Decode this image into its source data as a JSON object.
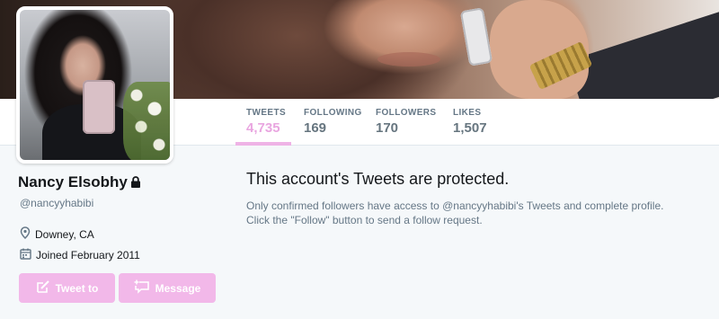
{
  "profile": {
    "name": "Nancy Elsobhy",
    "handle": "@nancyyhabibi",
    "location": "Downey, CA",
    "joined": "Joined February 2011"
  },
  "stats": [
    {
      "label": "TWEETS",
      "value": "4,735",
      "active": true
    },
    {
      "label": "FOLLOWING",
      "value": "169",
      "active": false
    },
    {
      "label": "FOLLOWERS",
      "value": "170",
      "active": false
    },
    {
      "label": "LIKES",
      "value": "1,507",
      "active": false
    }
  ],
  "actions": {
    "tweet_to": "Tweet to",
    "message": "Message"
  },
  "protected": {
    "title": "This account's Tweets are protected.",
    "line1": "Only confirmed followers have access to @nancyyhabibi's Tweets and complete profile.",
    "line2": "Click the \"Follow\" button to send a follow request."
  },
  "icons": {
    "lock": "lock-icon",
    "location": "location-pin-icon",
    "joined": "calendar-icon",
    "tweet": "compose-icon",
    "message": "message-icon"
  },
  "colors": {
    "accent": "#efb3e6",
    "button": "#f2b8e9",
    "background": "#f5f8fa"
  }
}
